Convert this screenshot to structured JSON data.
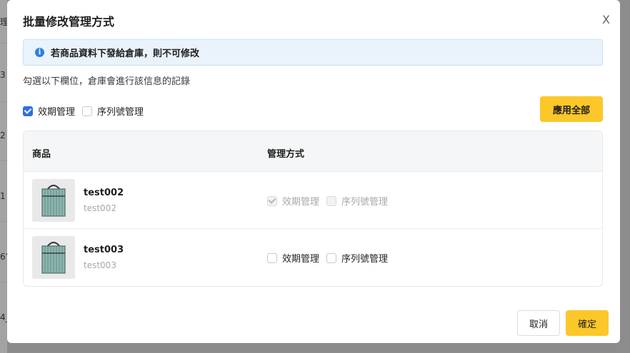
{
  "background": {
    "fragments": [
      "理",
      "3",
      "2",
      "1",
      "6’",
      "4_"
    ]
  },
  "modal": {
    "title": "批量修改管理方式",
    "close_label": "X"
  },
  "alert": {
    "icon": "info-icon",
    "icon_glyph": "i",
    "text": "若商品資料下發給倉庫，則不可修改"
  },
  "hint": "勾選以下欄位，倉庫會進行該信息的記錄",
  "global_options": [
    {
      "label": "效期管理",
      "checked": true
    },
    {
      "label": "序列號管理",
      "checked": false
    }
  ],
  "apply_all_label": "應用全部",
  "table": {
    "columns": [
      "商品",
      "管理方式"
    ],
    "rows": [
      {
        "name": "test002",
        "sku": "test002",
        "disabled": true,
        "options": [
          {
            "label": "效期管理",
            "checked": true
          },
          {
            "label": "序列號管理",
            "checked": false
          }
        ]
      },
      {
        "name": "test003",
        "sku": "test003",
        "disabled": false,
        "options": [
          {
            "label": "效期管理",
            "checked": false
          },
          {
            "label": "序列號管理",
            "checked": false
          }
        ]
      }
    ]
  },
  "footer": {
    "cancel_label": "取消",
    "ok_label": "確定"
  },
  "colors": {
    "primary_yellow": "#fcc729",
    "checkbox_blue": "#2f6fe0",
    "info_blue": "#2f7ee0"
  }
}
